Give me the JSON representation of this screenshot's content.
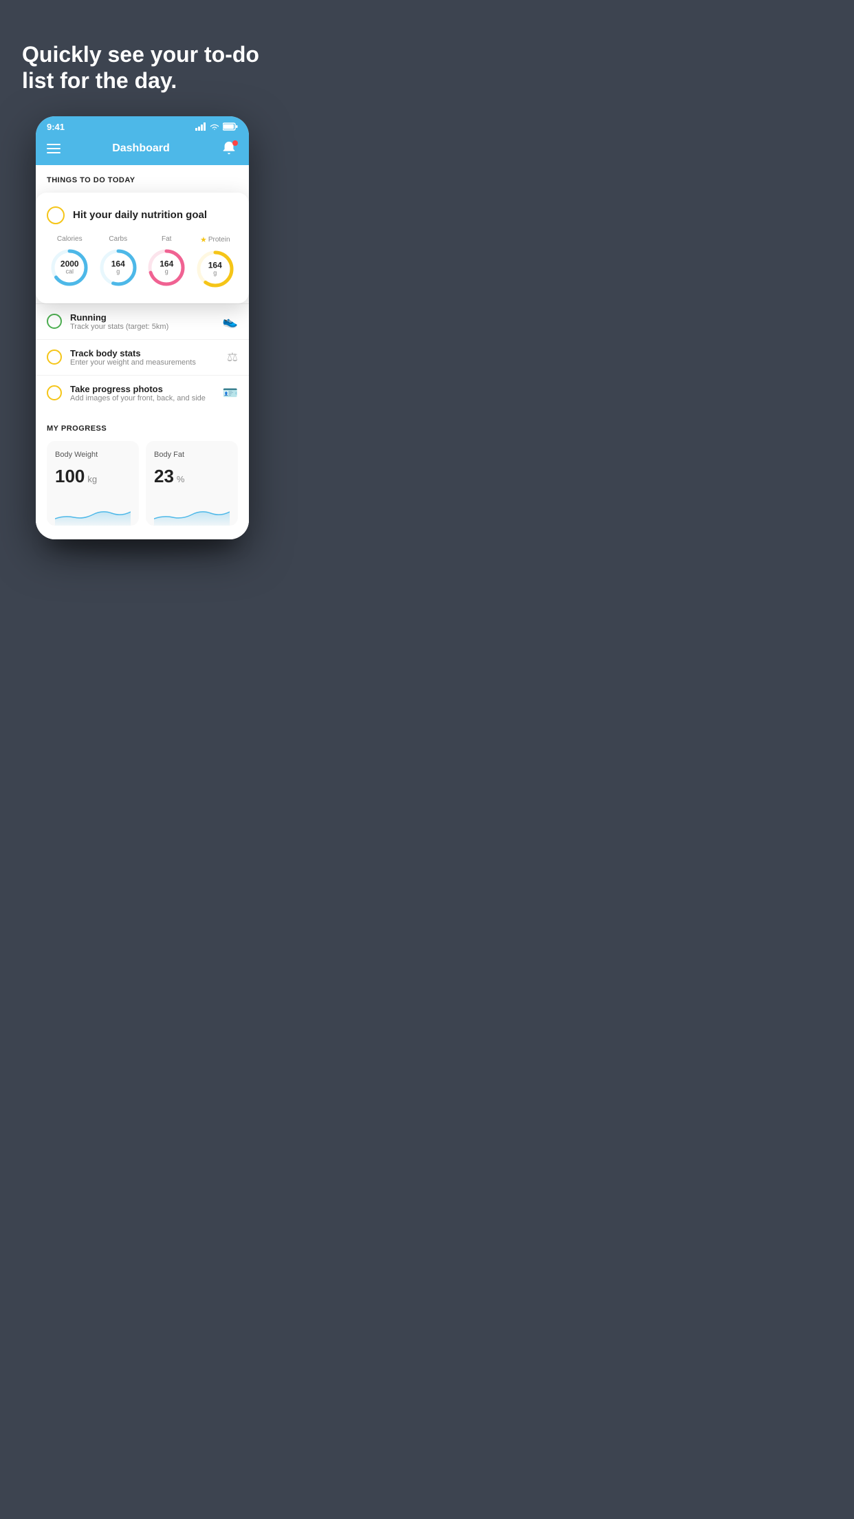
{
  "hero": {
    "text": "Quickly see your to-do list for the day."
  },
  "statusBar": {
    "time": "9:41",
    "icons": "signal wifi battery"
  },
  "navBar": {
    "title": "Dashboard"
  },
  "todoSection": {
    "header": "THINGS TO DO TODAY"
  },
  "floatingCard": {
    "title": "Hit your daily nutrition goal",
    "nutrition": [
      {
        "label": "Calories",
        "value": "2000",
        "unit": "cal",
        "color": "#4db8e8",
        "trackColor": "#e8f7fd",
        "percent": 65,
        "star": false
      },
      {
        "label": "Carbs",
        "value": "164",
        "unit": "g",
        "color": "#4db8e8",
        "trackColor": "#e8f7fd",
        "percent": 55,
        "star": false
      },
      {
        "label": "Fat",
        "value": "164",
        "unit": "g",
        "color": "#f06292",
        "trackColor": "#fce4ec",
        "percent": 70,
        "star": false
      },
      {
        "label": "Protein",
        "value": "164",
        "unit": "g",
        "color": "#f5c518",
        "trackColor": "#fff8e1",
        "percent": 60,
        "star": true
      }
    ]
  },
  "todoItems": [
    {
      "id": "running",
      "title": "Running",
      "sub": "Track your stats (target: 5km)",
      "circleColor": "green",
      "icon": "👟"
    },
    {
      "id": "body-stats",
      "title": "Track body stats",
      "sub": "Enter your weight and measurements",
      "circleColor": "yellow",
      "icon": "⚖"
    },
    {
      "id": "progress-photos",
      "title": "Take progress photos",
      "sub": "Add images of your front, back, and side",
      "circleColor": "yellow",
      "icon": "🪪"
    }
  ],
  "progressSection": {
    "title": "MY PROGRESS",
    "cards": [
      {
        "id": "body-weight",
        "title": "Body Weight",
        "value": "100",
        "unit": "kg"
      },
      {
        "id": "body-fat",
        "title": "Body Fat",
        "value": "23",
        "unit": "%"
      }
    ]
  }
}
